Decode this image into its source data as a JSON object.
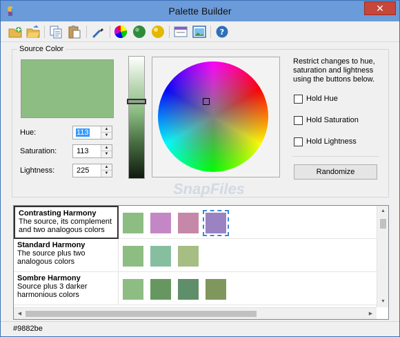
{
  "window": {
    "title": "Palette Builder"
  },
  "titlebar": {
    "close_label": "✕"
  },
  "toolbar": {
    "buttons": [
      {
        "name": "new-palette-icon"
      },
      {
        "name": "open-folder-icon"
      },
      {
        "name": "copy-icon"
      },
      {
        "name": "paste-icon"
      },
      {
        "name": "eyedropper-icon"
      },
      {
        "name": "color-wheel-icon"
      },
      {
        "name": "green-sphere-icon"
      },
      {
        "name": "yellow-sphere-icon"
      },
      {
        "name": "window-icon"
      },
      {
        "name": "image-icon"
      },
      {
        "name": "help-icon"
      }
    ]
  },
  "source": {
    "group_label": "Source Color",
    "color": "#8dbd83",
    "hue_label": "Hue:",
    "hue_value": "113",
    "saturation_label": "Saturation:",
    "saturation_value": "113",
    "lightness_label": "Lightness:",
    "lightness_value": "225"
  },
  "restrict": {
    "text": "Restrict changes to hue, saturation and lightness using the buttons below.",
    "hold_hue": "Hold Hue",
    "hold_saturation": "Hold Saturation",
    "hold_lightness": "Hold Lightness",
    "randomize": "Randomize"
  },
  "watermark": "SnapFiles",
  "harmonies": [
    {
      "title": "Contrasting Harmony",
      "desc": "The source, its complement and two analogous colors",
      "colors": [
        "#8dbd83",
        "#c487c6",
        "#c588a8",
        "#9a82c3"
      ]
    },
    {
      "title": "Standard Harmony",
      "desc": "The source plus two analogous colors",
      "colors": [
        "#8dbd83",
        "#86bfa0",
        "#a6bd83"
      ]
    },
    {
      "title": "Sombre Harmony",
      "desc": "Source plus 3 darker harmonious colors",
      "colors": [
        "#8dbd83",
        "#679760",
        "#5e8e6a",
        "#7f975c"
      ]
    }
  ],
  "status": "#9882be"
}
